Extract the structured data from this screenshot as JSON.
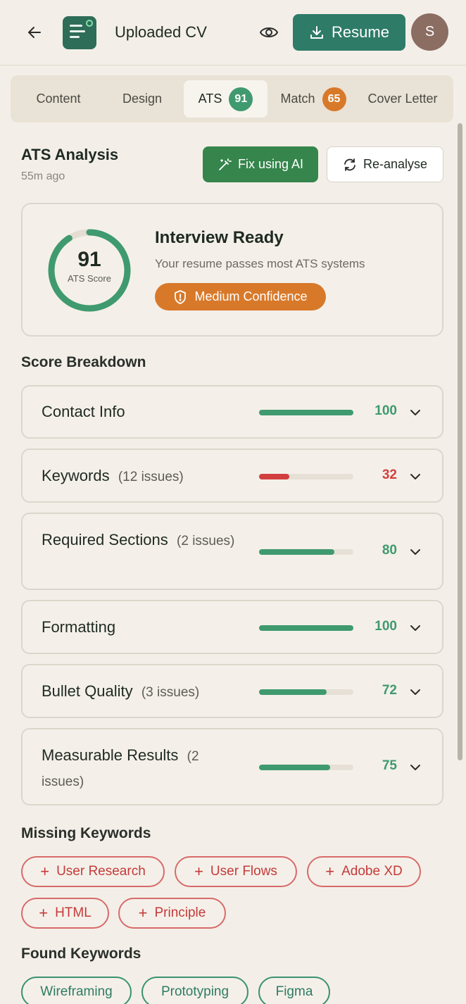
{
  "header": {
    "title": "Uploaded CV",
    "resume_label": "Resume",
    "avatar_initial": "S"
  },
  "tabs": [
    {
      "label": "Content"
    },
    {
      "label": "Design"
    },
    {
      "label": "ATS",
      "badge": "91"
    },
    {
      "label": "Match",
      "badge": "65"
    },
    {
      "label": "Cover Letter"
    }
  ],
  "ats": {
    "title": "ATS Analysis",
    "time": "55m ago",
    "fix_label": "Fix using AI",
    "reanalyse_label": "Re-analyse"
  },
  "score_card": {
    "score": "91",
    "score_fraction": 0.91,
    "score_label": "ATS Score",
    "status": "Interview Ready",
    "description": "Your resume passes most ATS systems",
    "confidence": "Medium Confidence"
  },
  "breakdown": {
    "title": "Score Breakdown",
    "rows": [
      {
        "label": "Contact Info",
        "issues": "",
        "value": "100",
        "fraction": 1.0
      },
      {
        "label": "Keywords",
        "issues": "(12 issues)",
        "value": "32",
        "fraction": 0.32
      },
      {
        "label": "Required Sections",
        "issues": "(2 issues)",
        "value": "80",
        "fraction": 0.8
      },
      {
        "label": "Formatting",
        "issues": "",
        "value": "100",
        "fraction": 1.0
      },
      {
        "label": "Bullet Quality",
        "issues": "(3 issues)",
        "value": "72",
        "fraction": 0.72
      },
      {
        "label": "Measurable Results",
        "issues": "(2 issues)",
        "value": "75",
        "fraction": 0.75
      }
    ]
  },
  "missing_keywords": {
    "title": "Missing Keywords",
    "items": [
      "User Research",
      "User Flows",
      "Adobe XD",
      "HTML",
      "Principle"
    ]
  },
  "found_keywords": {
    "title": "Found Keywords",
    "items": [
      "Wireframing",
      "Prototyping",
      "Figma"
    ]
  },
  "colors": {
    "green": "#3f9a6f",
    "red": "#d23f3f",
    "orange": "#d8792a",
    "primary": "#2e7b68"
  }
}
